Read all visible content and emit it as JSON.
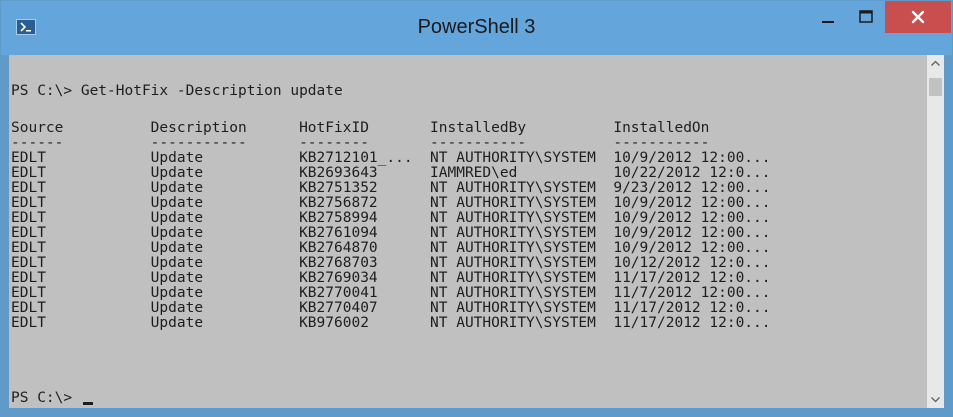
{
  "window": {
    "title": "PowerShell 3",
    "close_glyph": "✕"
  },
  "console": {
    "command_line": "PS C:\\> Get-HotFix -Description update",
    "headers": [
      "Source",
      "Description",
      "HotFixID",
      "InstalledBy",
      "InstalledOn"
    ],
    "header_line": "Source          Description      HotFixID       InstalledBy          InstalledOn",
    "dash_line": "------          -----------      --------       -----------          -----------",
    "rows": [
      "EDLT            Update           KB2712101_...  NT AUTHORITY\\SYSTEM  10/9/2012 12:00...",
      "EDLT            Update           KB2693643      IAMMRED\\ed           10/22/2012 12:0...",
      "EDLT            Update           KB2751352      NT AUTHORITY\\SYSTEM  9/23/2012 12:00...",
      "EDLT            Update           KB2756872      NT AUTHORITY\\SYSTEM  10/9/2012 12:00...",
      "EDLT            Update           KB2758994      NT AUTHORITY\\SYSTEM  10/9/2012 12:00...",
      "EDLT            Update           KB2761094      NT AUTHORITY\\SYSTEM  10/9/2012 12:00...",
      "EDLT            Update           KB2764870      NT AUTHORITY\\SYSTEM  10/9/2012 12:00...",
      "EDLT            Update           KB2768703      NT AUTHORITY\\SYSTEM  10/12/2012 12:0...",
      "EDLT            Update           KB2769034      NT AUTHORITY\\SYSTEM  11/17/2012 12:0...",
      "EDLT            Update           KB2770041      NT AUTHORITY\\SYSTEM  11/7/2012 12:00...",
      "EDLT            Update           KB2770407      NT AUTHORITY\\SYSTEM  11/17/2012 12:0...",
      "EDLT            Update           KB976002       NT AUTHORITY\\SYSTEM  11/17/2012 12:0..."
    ],
    "prompt": "PS C:\\>"
  },
  "colors": {
    "titlebar": "#64a5dc",
    "console_bg": "#c0c0c0",
    "console_text": "#1e1e1e",
    "close_button": "#c94f4f"
  },
  "icons": {
    "app": "powershell-icon",
    "minimize": "minimize-icon",
    "maximize": "maximize-icon",
    "close": "close-icon",
    "scroll_up": "chevron-up-icon",
    "scroll_down": "chevron-down-icon"
  }
}
